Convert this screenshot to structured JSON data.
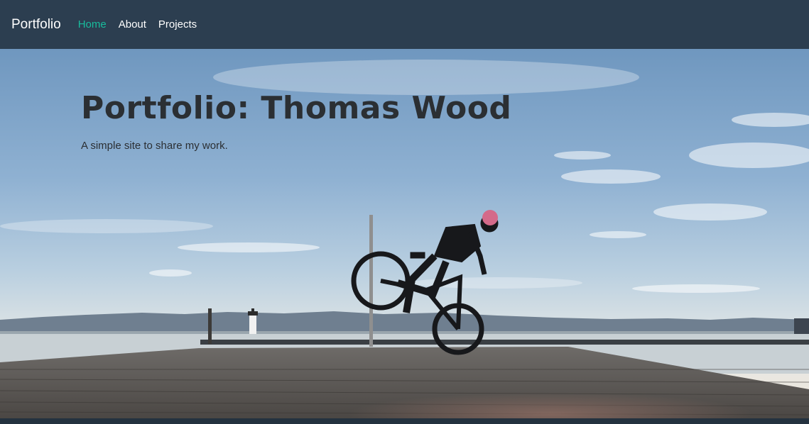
{
  "navbar": {
    "brand": "Portfolio",
    "links": [
      {
        "label": "Home",
        "active": true
      },
      {
        "label": "About",
        "active": false
      },
      {
        "label": "Projects",
        "active": false
      }
    ]
  },
  "hero": {
    "title": "Portfolio: Thomas Wood",
    "subtitle": "A simple site to share my work.",
    "background_photo": "cyclist-on-pier-at-sunset"
  },
  "colors": {
    "navbar_bg": "#2c3e50",
    "active_link": "#18bc9c",
    "link": "#ffffff"
  }
}
